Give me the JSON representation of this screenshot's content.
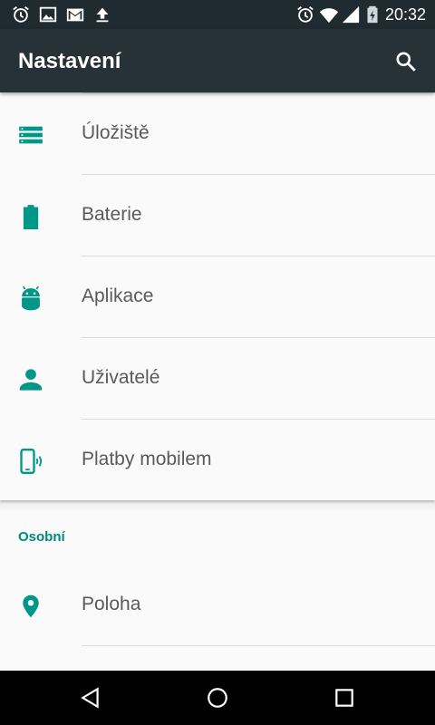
{
  "status_bar": {
    "time": "20:32",
    "left_icons": [
      "alarm-icon",
      "image-icon",
      "gmail-icon",
      "upload-icon"
    ],
    "right_icons": [
      "alarm-icon",
      "wifi-icon",
      "signal-icon",
      "battery-charging-icon"
    ]
  },
  "toolbar": {
    "title": "Nastavení",
    "search_icon": "search-icon"
  },
  "colors": {
    "accent": "#00897b",
    "toolbar": "#263238",
    "status_bar": "#1f2b30",
    "icon": "#009688",
    "text": "#5a5a5a"
  },
  "settings_items": [
    {
      "label": "Úložiště",
      "icon": "storage-icon"
    },
    {
      "label": "Baterie",
      "icon": "battery-icon"
    },
    {
      "label": "Aplikace",
      "icon": "android-icon"
    },
    {
      "label": "Uživatelé",
      "icon": "person-icon"
    },
    {
      "label": "Platby mobilem",
      "icon": "tap-pay-icon"
    }
  ],
  "personal_section": {
    "header": "Osobní",
    "items": [
      {
        "label": "Poloha",
        "icon": "location-icon"
      }
    ]
  },
  "nav_bar": {
    "buttons": [
      "back-icon",
      "home-icon",
      "recents-icon"
    ]
  }
}
